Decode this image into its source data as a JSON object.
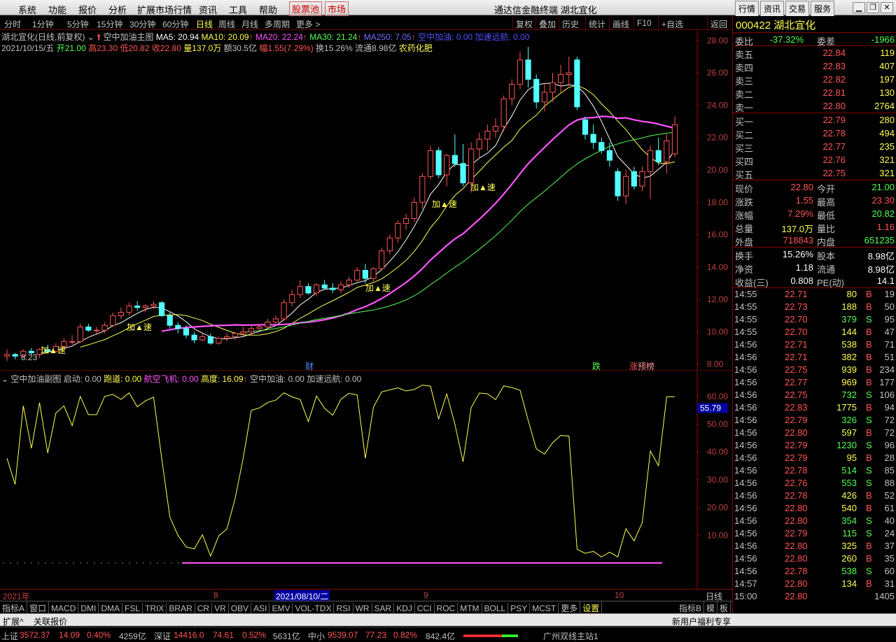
{
  "menu": {
    "items": [
      "系统",
      "功能",
      "报价",
      "分析",
      "扩展市场行情",
      "资讯",
      "工具",
      "帮助"
    ],
    "stock_pool": "股票池",
    "market": "市场",
    "app_title": "通达信金融终端  湖北宜化",
    "right_buttons": [
      "行情",
      "资讯",
      "交易",
      "服务"
    ]
  },
  "toolbar": {
    "periods": [
      "分时",
      "1分钟",
      "5分钟",
      "15分钟",
      "30分钟",
      "60分钟",
      "日线",
      "周线",
      "月线",
      "多周期",
      "更多 >"
    ],
    "active": "日线",
    "right": [
      "复权",
      "叠加",
      "历史",
      "统计",
      "画线",
      "F10",
      "+自选",
      "返回"
    ]
  },
  "info": {
    "name": "湖北宜化(日线,前复权)",
    "indicator": "空中加油主图",
    "ma5": "MA5: 20.94",
    "ma10": "MA10: 20.09",
    "ma20": "MA20: 22.24",
    "ma30": "MA30: 21.24",
    "ma250": "MA250: 7.05",
    "kzjy": "空中加油: 0.00",
    "jsyh": "加速远航: 0.00",
    "date": "2021/10/15/五",
    "open": "开21.00",
    "high": "高23.30",
    "low": "低20.82",
    "close": "收22.80",
    "vol": "量137.0万",
    "amt": "额30.5亿",
    "chg": "幅1.55(7.29%)",
    "turn": "换15.26%",
    "float": "流通8.98亿",
    "sector": "农药化肥"
  },
  "sub": {
    "title": "空中加油副图",
    "qd": "启动: 0.00",
    "pd": "跑道: 0.00",
    "hk": "航空飞机: 0.00",
    "gd": "高度: 16.09",
    "kz": "空中加油: 0.00",
    "js": "加速远航: 0.00",
    "current": "55.79"
  },
  "xaxis": {
    "labels": [
      "2021年",
      "8",
      "2021/08/10/二",
      "9",
      "10"
    ],
    "right": "日线"
  },
  "main_markers": {
    "cai": "财",
    "die": "跌",
    "zhang": "涨",
    "yubang": "预榜",
    "low_label": "8.23",
    "speed": "加▲速"
  },
  "indicators": [
    "指标A",
    "窗口",
    "MACD",
    "DMI",
    "DMA",
    "FSL",
    "TRIX",
    "BRAR",
    "CR",
    "VR",
    "OBV",
    "ASI",
    "EMV",
    "VOL-TDX",
    "RSI",
    "WR",
    "SAR",
    "KDJ",
    "CCI",
    "ROC",
    "MTM",
    "BOLL",
    "PSY",
    "MCST",
    "更多",
    "设置"
  ],
  "ind_right": [
    "指标B",
    "模",
    "板"
  ],
  "ext": {
    "left1": "扩展^",
    "left2": "关联报价",
    "right1": "新用户福利专享"
  },
  "status": {
    "sh": "上证",
    "sh_v": "3572.37",
    "sh_c": "14.09",
    "sh_p": "0.40%",
    "sh_a": "4259亿",
    "sz": "深证",
    "sz_v": "14416.0",
    "sz_c": "74.61",
    "sz_p": "0.52%",
    "sz_a": "5631亿",
    "zx": "中小",
    "zx_v": "9539.07",
    "zx_c": "77.23",
    "zx_p": "0.82%",
    "zx_a": "842.4亿",
    "site": "广州双线主站1"
  },
  "quote": {
    "code": "000422",
    "name": "湖北宜化",
    "weibi": {
      "label": "委比",
      "value": "-37.32%",
      "label2": "委差",
      "value2": "-1966"
    },
    "sells": [
      {
        "l": "卖五",
        "p": "22.84",
        "v": "119"
      },
      {
        "l": "卖四",
        "p": "22.83",
        "v": "407"
      },
      {
        "l": "卖三",
        "p": "22.82",
        "v": "197"
      },
      {
        "l": "卖二",
        "p": "22.81",
        "v": "130"
      },
      {
        "l": "卖一",
        "p": "22.80",
        "v": "2764"
      }
    ],
    "buys": [
      {
        "l": "买一",
        "p": "22.79",
        "v": "280"
      },
      {
        "l": "买二",
        "p": "22.78",
        "v": "494"
      },
      {
        "l": "买三",
        "p": "22.77",
        "v": "235"
      },
      {
        "l": "买四",
        "p": "22.76",
        "v": "321"
      },
      {
        "l": "买五",
        "p": "22.75",
        "v": "321"
      }
    ],
    "stats": [
      [
        "现价",
        "22.80",
        "今开",
        "21.00"
      ],
      [
        "涨跌",
        "1.55",
        "最高",
        "23.30"
      ],
      [
        "涨幅",
        "7.29%",
        "最低",
        "20.82"
      ],
      [
        "总量",
        "137.0万",
        "量比",
        "1.16"
      ],
      [
        "外盘",
        "718843",
        "内盘",
        "651235"
      ]
    ],
    "stats2": [
      [
        "换手",
        "15.26%",
        "股本",
        "8.98亿"
      ],
      [
        "净资",
        "1.18",
        "流通",
        "8.98亿"
      ],
      [
        "收益(三)",
        "0.808",
        "PE(动)",
        "14.1"
      ]
    ],
    "ticks": [
      [
        "14:55",
        "22.71",
        "80",
        "B",
        "19"
      ],
      [
        "14:55",
        "22.73",
        "188",
        "B",
        "50"
      ],
      [
        "14:55",
        "22.70",
        "379",
        "S",
        "95"
      ],
      [
        "14:55",
        "22.70",
        "144",
        "B",
        "47"
      ],
      [
        "14:56",
        "22.71",
        "538",
        "B",
        "71"
      ],
      [
        "14:56",
        "22.71",
        "382",
        "B",
        "51"
      ],
      [
        "14:56",
        "22.75",
        "939",
        "B",
        "234"
      ],
      [
        "14:56",
        "22.77",
        "969",
        "B",
        "177"
      ],
      [
        "14:56",
        "22.75",
        "732",
        "S",
        "106"
      ],
      [
        "14:56",
        "22.83",
        "1775",
        "B",
        "94"
      ],
      [
        "14:56",
        "22.79",
        "326",
        "S",
        "72"
      ],
      [
        "14:56",
        "22.80",
        "597",
        "B",
        "72"
      ],
      [
        "14:56",
        "22.79",
        "1230",
        "S",
        "96"
      ],
      [
        "14:56",
        "22.79",
        "95",
        "B",
        "28"
      ],
      [
        "14:56",
        "22.78",
        "514",
        "S",
        "85"
      ],
      [
        "14:56",
        "22.76",
        "553",
        "S",
        "88"
      ],
      [
        "14:56",
        "22.78",
        "426",
        "B",
        "52"
      ],
      [
        "14:56",
        "22.80",
        "540",
        "B",
        "61"
      ],
      [
        "14:56",
        "22.80",
        "354",
        "S",
        "40"
      ],
      [
        "14:56",
        "22.79",
        "115",
        "S",
        "24"
      ],
      [
        "14:56",
        "22.80",
        "325",
        "B",
        "37"
      ],
      [
        "14:56",
        "22.80",
        "260",
        "B",
        "35"
      ],
      [
        "14:56",
        "22.78",
        "538",
        "S",
        "60"
      ],
      [
        "14:57",
        "22.80",
        "134",
        "B",
        "31"
      ],
      [
        "15:00",
        "22.80",
        "",
        "",
        "1405"
      ]
    ]
  },
  "chart_data": {
    "type": "candlestick",
    "title": "湖北宜化(日线,前复权)",
    "y_axis_ticks": [
      8,
      10,
      12,
      14,
      16,
      18,
      20,
      22,
      24,
      26,
      28
    ],
    "ylim": [
      7.6,
      28.6
    ],
    "sub_y_axis_ticks": [
      10,
      20,
      30,
      40,
      50,
      60
    ],
    "sub_ylim": [
      0,
      68
    ],
    "candles": [
      [
        8.5,
        8.9,
        8.2,
        8.6
      ],
      [
        8.6,
        8.7,
        8.3,
        8.5
      ],
      [
        8.5,
        8.9,
        8.4,
        8.8
      ],
      [
        8.8,
        9.0,
        8.6,
        8.7
      ],
      [
        8.6,
        9.0,
        8.4,
        8.9
      ],
      [
        8.9,
        9.2,
        8.7,
        8.8
      ],
      [
        8.8,
        9.3,
        8.7,
        9.1
      ],
      [
        9.1,
        9.6,
        9.0,
        9.4
      ],
      [
        9.4,
        9.8,
        9.2,
        9.4
      ],
      [
        9.4,
        10.5,
        9.3,
        10.3
      ],
      [
        10.3,
        10.5,
        10.0,
        10.1
      ],
      [
        10.1,
        10.3,
        9.8,
        10.1
      ],
      [
        10.1,
        10.6,
        9.9,
        10.4
      ],
      [
        10.4,
        11.2,
        10.3,
        11.0
      ],
      [
        11.0,
        11.5,
        10.8,
        11.2
      ],
      [
        11.2,
        11.8,
        11.0,
        11.6
      ],
      [
        11.6,
        11.9,
        11.3,
        11.5
      ],
      [
        11.5,
        11.7,
        11.2,
        11.6
      ],
      [
        11.6,
        11.9,
        11.4,
        11.7
      ],
      [
        11.8,
        11.9,
        10.9,
        11.0
      ],
      [
        11.0,
        11.2,
        10.2,
        10.4
      ],
      [
        10.4,
        10.6,
        9.9,
        10.2
      ],
      [
        10.2,
        10.4,
        9.6,
        9.8
      ],
      [
        9.8,
        10.0,
        9.3,
        9.5
      ],
      [
        9.5,
        9.9,
        9.4,
        9.7
      ],
      [
        9.7,
        9.9,
        9.2,
        9.3
      ],
      [
        9.3,
        9.7,
        9.2,
        9.6
      ],
      [
        9.6,
        9.9,
        9.4,
        9.7
      ],
      [
        9.7,
        10.0,
        9.5,
        9.9
      ],
      [
        9.9,
        10.3,
        9.7,
        10.0
      ],
      [
        10.0,
        10.4,
        9.8,
        10.2
      ],
      [
        10.2,
        10.5,
        10.0,
        10.3
      ],
      [
        10.3,
        10.8,
        10.1,
        10.6
      ],
      [
        10.6,
        11.0,
        10.4,
        10.8
      ],
      [
        10.8,
        12.0,
        10.7,
        11.8
      ],
      [
        11.8,
        12.6,
        11.6,
        12.3
      ],
      [
        12.3,
        13.2,
        12.1,
        12.8
      ],
      [
        12.8,
        13.0,
        12.3,
        12.4
      ],
      [
        12.4,
        13.0,
        12.2,
        12.9
      ],
      [
        12.9,
        13.2,
        12.6,
        12.7
      ],
      [
        12.7,
        13.0,
        12.4,
        12.6
      ],
      [
        12.6,
        13.1,
        12.4,
        12.9
      ],
      [
        12.9,
        13.4,
        12.7,
        13.2
      ],
      [
        13.2,
        14.0,
        13.1,
        13.8
      ],
      [
        13.8,
        14.2,
        13.0,
        13.3
      ],
      [
        13.3,
        14.0,
        13.1,
        13.9
      ],
      [
        13.9,
        15.2,
        13.8,
        15.0
      ],
      [
        15.0,
        16.0,
        14.8,
        15.8
      ],
      [
        15.8,
        16.9,
        15.5,
        16.7
      ],
      [
        16.7,
        17.3,
        16.3,
        17.0
      ],
      [
        17.0,
        18.3,
        16.8,
        18.0
      ],
      [
        18.0,
        19.8,
        17.6,
        19.6
      ],
      [
        19.6,
        21.5,
        19.4,
        21.2
      ],
      [
        21.2,
        21.4,
        19.5,
        19.7
      ],
      [
        19.7,
        21.0,
        19.0,
        20.9
      ],
      [
        20.9,
        22.2,
        20.2,
        20.4
      ],
      [
        20.4,
        21.6,
        19.0,
        19.2
      ],
      [
        19.2,
        21.7,
        18.6,
        21.3
      ],
      [
        21.3,
        22.3,
        20.7,
        21.9
      ],
      [
        21.9,
        22.8,
        21.2,
        22.4
      ],
      [
        22.4,
        23.2,
        22.0,
        22.7
      ],
      [
        22.7,
        24.6,
        22.4,
        24.4
      ],
      [
        24.4,
        25.6,
        24.0,
        25.3
      ],
      [
        25.3,
        27.3,
        25.0,
        26.8
      ],
      [
        26.8,
        27.6,
        25.1,
        25.6
      ],
      [
        25.6,
        25.9,
        23.8,
        24.2
      ],
      [
        24.2,
        25.3,
        23.6,
        24.8
      ],
      [
        24.8,
        26.0,
        24.2,
        25.4
      ],
      [
        25.4,
        26.5,
        24.8,
        25.9
      ],
      [
        25.9,
        27.0,
        25.2,
        26.0
      ],
      [
        26.8,
        27.0,
        23.7,
        23.9
      ],
      [
        23.1,
        23.3,
        21.9,
        22.2
      ],
      [
        22.2,
        22.8,
        21.3,
        21.7
      ],
      [
        21.7,
        22.0,
        21.0,
        21.2
      ],
      [
        21.2,
        21.7,
        20.2,
        20.6
      ],
      [
        19.9,
        20.1,
        18.1,
        18.4
      ],
      [
        18.4,
        20.0,
        17.9,
        19.6
      ],
      [
        19.9,
        20.2,
        18.8,
        19.0
      ],
      [
        19.0,
        20.2,
        18.7,
        19.9
      ],
      [
        19.9,
        21.5,
        18.2,
        21.2
      ],
      [
        21.2,
        22.0,
        20.3,
        20.5
      ],
      [
        20.5,
        22.2,
        19.8,
        21.8
      ],
      [
        21.0,
        23.3,
        20.8,
        22.8
      ]
    ]
  }
}
